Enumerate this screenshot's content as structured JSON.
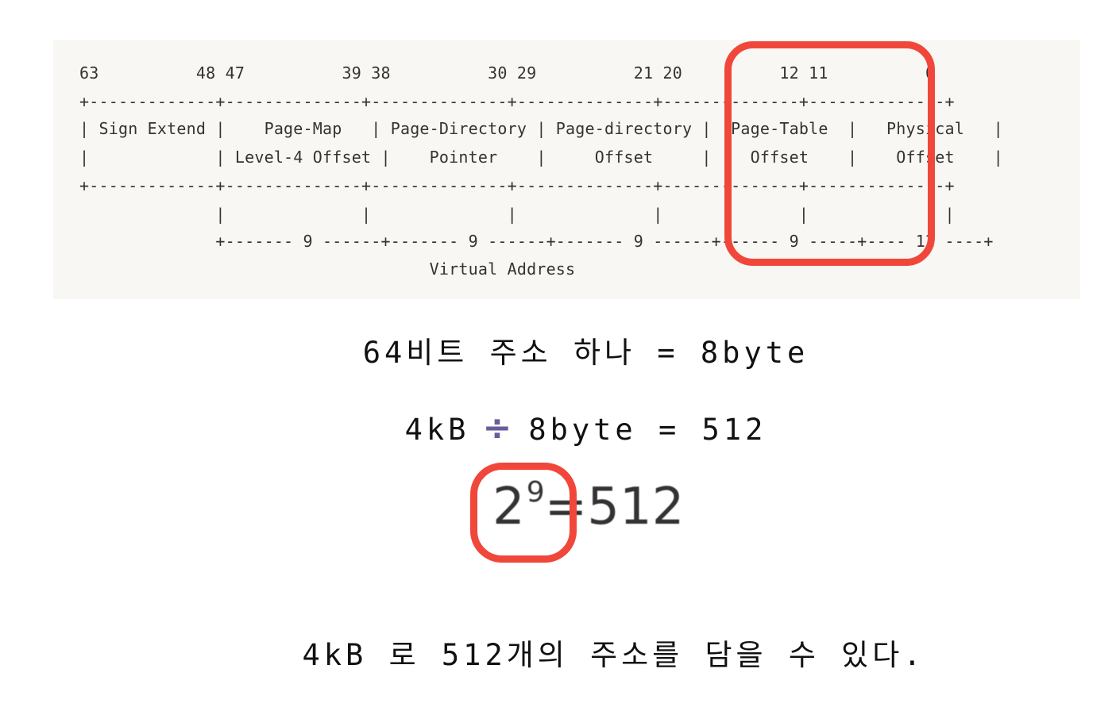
{
  "diagram": {
    "lines": [
      "63          48 47          39 38          30 29          21 20          12 11          0",
      "+-------------+--------------+--------------+--------------+--------------+--------------+",
      "| Sign Extend |    Page-Map   | Page-Directory | Page-directory |  Page-Table  |   Physical   |",
      "|             | Level-4 Offset |    Pointer    |     Offset     |    Offset    |    Offset    |",
      "+-------------+--------------+--------------+--------------+--------------+--------------+",
      "              |              |              |              |              |              |",
      "              +------- 9 ------+------- 9 ------+------- 9 ------+------ 9 -----+---- 12 ----+",
      "                                    Virtual Address"
    ]
  },
  "captions": {
    "line1": "64비트 주소 하나 = 8byte",
    "line2_left": "4kB",
    "line2_op": "÷",
    "line2_right": "8byte = 512",
    "line4": "4kB 로 512개의 주소를 담을 수 있다."
  },
  "equation": {
    "base": "2",
    "exponent": "9",
    "rest": "=512"
  },
  "colors": {
    "highlight": "#f0473a",
    "divide_sign": "#6a5b9b",
    "code_background": "#f8f7f3"
  }
}
